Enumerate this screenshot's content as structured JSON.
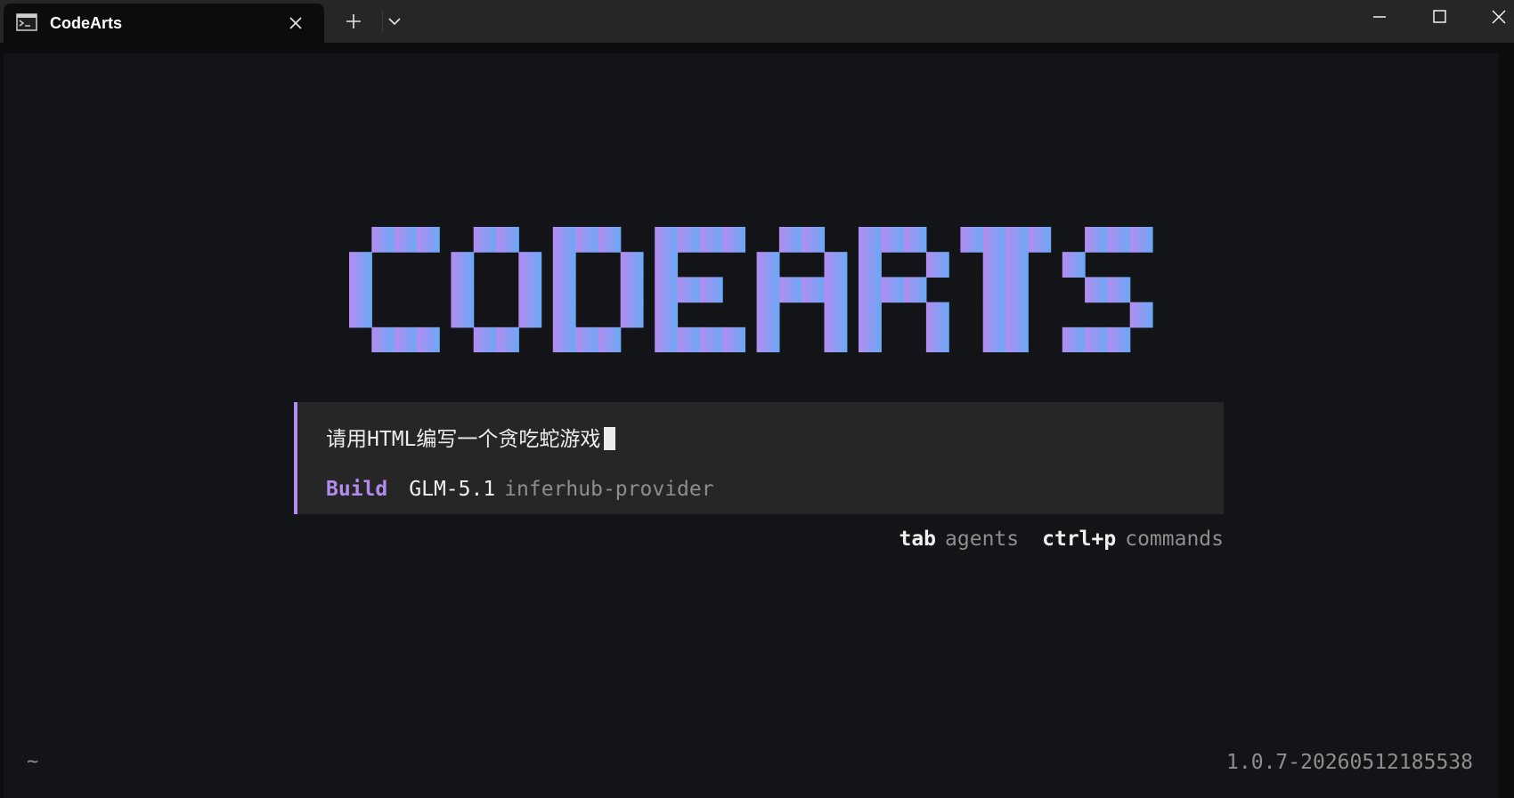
{
  "window": {
    "tab_title": "CodeArts"
  },
  "terminal": {
    "logo_text": "CODEARTS",
    "logo_gradient": [
      "#b48cf0",
      "#6aa9f5"
    ],
    "prompt_input": "请用HTML编写一个贪吃蛇游戏",
    "agent": "Build",
    "model": "GLM-5.1",
    "provider": "inferhub-provider",
    "shortcuts": [
      {
        "key": "tab",
        "label": "agents"
      },
      {
        "key": "ctrl+p",
        "label": "commands"
      }
    ],
    "cwd": "~",
    "version": "1.0.7-20260512185538"
  },
  "colors": {
    "accent_purple": "#b48cf0",
    "accent_blue": "#6aa9f5",
    "background": "#131417",
    "panel": "#262626"
  },
  "icons": {
    "tab_icon": "terminal-icon",
    "tab_close": "close-icon",
    "new_tab": "plus-icon",
    "tab_menu": "chevron-down-icon",
    "minimize": "minimize-icon",
    "maximize": "maximize-icon",
    "close": "close-icon"
  }
}
